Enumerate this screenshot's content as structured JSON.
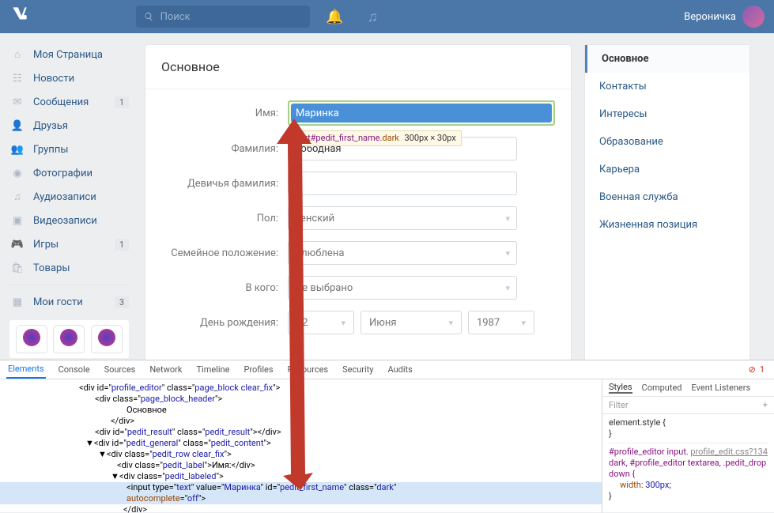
{
  "top": {
    "search_placeholder": "Поиск",
    "user": "Вероничка"
  },
  "nav": {
    "items": [
      {
        "ico": "home",
        "label": "Моя Страница"
      },
      {
        "ico": "news",
        "label": "Новости"
      },
      {
        "ico": "msg",
        "label": "Сообщения",
        "badge": "1"
      },
      {
        "ico": "friends",
        "label": "Друзья"
      },
      {
        "ico": "groups",
        "label": "Группы"
      },
      {
        "ico": "photo",
        "label": "Фотографии"
      },
      {
        "ico": "audio",
        "label": "Аудиозаписи"
      },
      {
        "ico": "video",
        "label": "Видеозаписи"
      },
      {
        "ico": "games",
        "label": "Игры",
        "badge": "1"
      },
      {
        "ico": "market",
        "label": "Товары"
      }
    ],
    "guests": {
      "label": "Мои гости",
      "badge": "3"
    }
  },
  "editor": {
    "title": "Основное",
    "rows": {
      "name": {
        "label": "Имя:",
        "value": "Маринка"
      },
      "surname": {
        "label": "Фамилия:",
        "value": "вободная"
      },
      "maiden": {
        "label": "Девичья фамилия:",
        "value": ""
      },
      "sex": {
        "label": "Пол:",
        "value": "кенский"
      },
      "marital": {
        "label": "Семейное положение:",
        "value": "Влюблена"
      },
      "whom": {
        "label": "В кого:",
        "value": "Не выбрано"
      },
      "bday": {
        "label": "День рождения:",
        "d": "12",
        "m": "Июня",
        "y": "1987"
      }
    }
  },
  "rnav": {
    "items": [
      "Основное",
      "Контакты",
      "Интересы",
      "Образование",
      "Карьера",
      "Военная служба",
      "Жизненная позиция"
    ]
  },
  "tooltip": {
    "sel": "ut#pedit_first_name.",
    "cls": "dark",
    "dim": "300px × 30px"
  },
  "dev": {
    "tabs": [
      "Elements",
      "Console",
      "Sources",
      "Network",
      "Timeline",
      "Profiles",
      "Resources",
      "Security",
      "Audits"
    ],
    "err": "1",
    "styles": {
      "tabs": [
        "Styles",
        "Computed",
        "Event Listeners"
      ],
      "filter": "Filter",
      "rule1": "element.style {",
      "rule1b": "}",
      "link": "profile_edit.css?134",
      "sel": "#profile_editor input.dark, #profile_editor textarea, .pedit_dropdown {",
      "prop": "width",
      "val": "300px;",
      "close": "}"
    },
    "dom": {
      "l0": "<div id=\"profile_editor\" class=\"page_block clear_fix\">",
      "l1": "<div class=\"page_block_header\">",
      "l2": "Основное",
      "l3": "</div>",
      "l4": "<div id=\"pedit_result\" class=\"pedit_result\"></div>",
      "l5": "▼<div id=\"pedit_general\" class=\"pedit_content\">",
      "l6": "▼<div class=\"pedit_row clear_fix\">",
      "l7": "<div class=\"pedit_label\">Имя:</div>",
      "l8": "▼<div class=\"pedit_labeled\">",
      "l9a": "<input type=\"text\" value=\"",
      "l9v": "Маринка",
      "l9b": "\" id=\"pedit_first_name\" class=\"dark\"",
      "l10": "autocomplete=\"off\">",
      "l11": "</div>"
    }
  }
}
